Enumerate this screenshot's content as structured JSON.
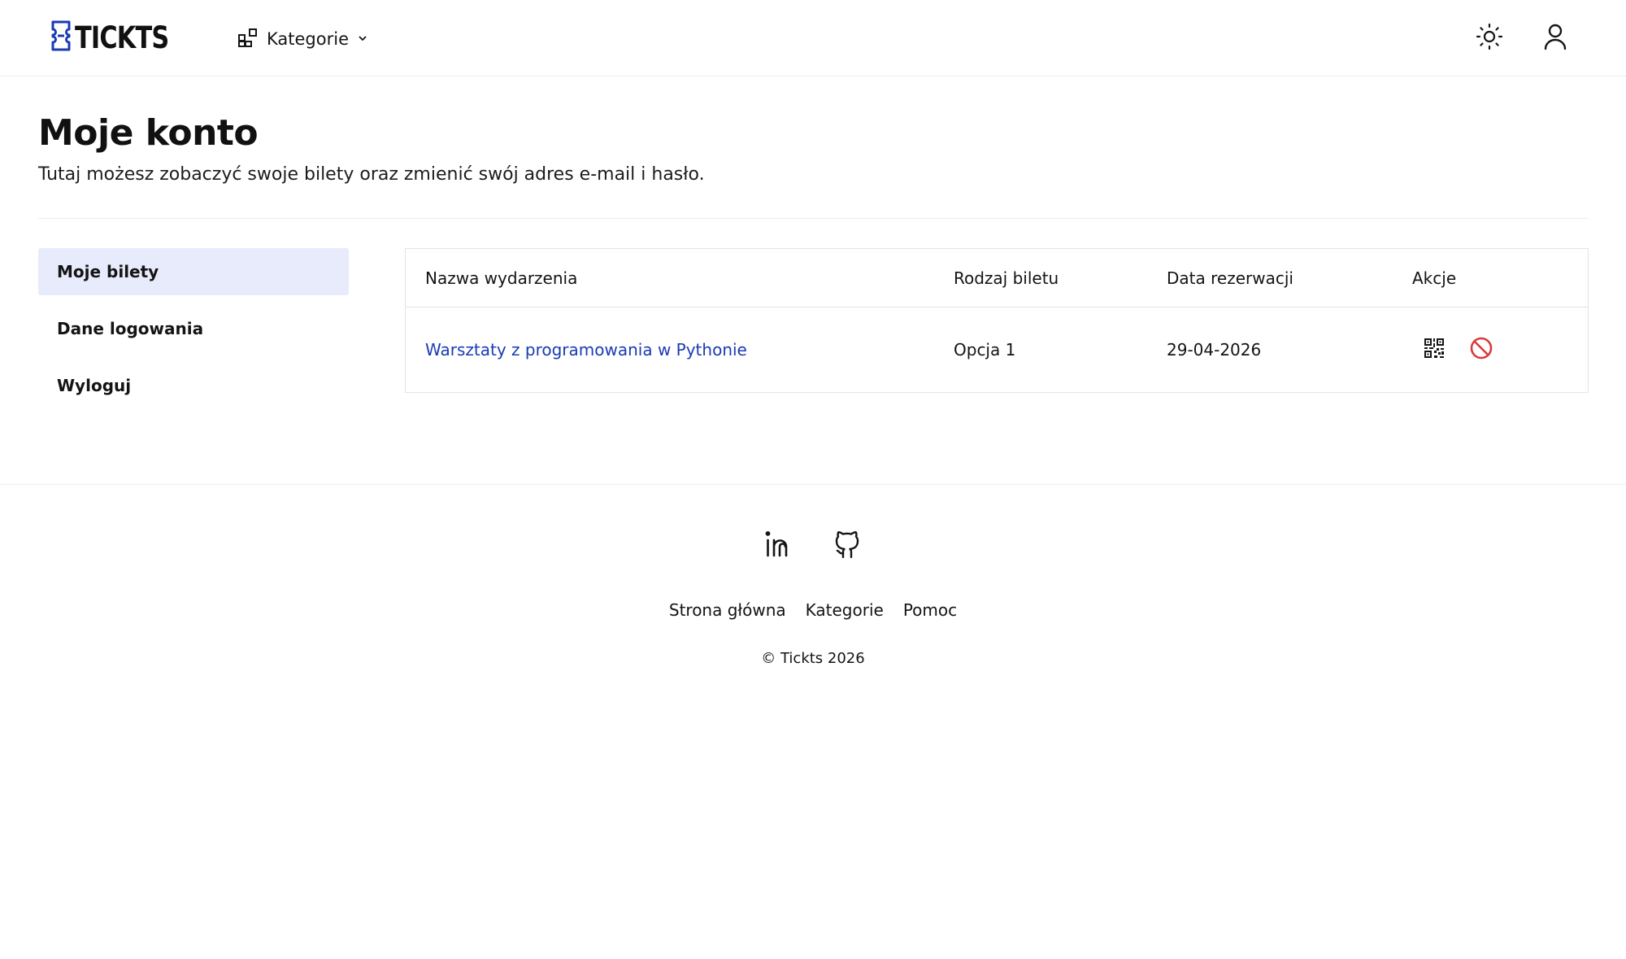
{
  "header": {
    "logo_text": "TICKTS",
    "categories_label": "Kategorie"
  },
  "page": {
    "title": "Moje konto",
    "subtitle": "Tutaj możesz zobaczyć swoje bilety oraz zmienić swój adres e-mail i hasło."
  },
  "sidebar": {
    "items": [
      {
        "label": "Moje bilety",
        "active": true
      },
      {
        "label": "Dane logowania",
        "active": false
      },
      {
        "label": "Wyloguj",
        "active": false
      }
    ]
  },
  "table": {
    "headers": [
      "Nazwa wydarzenia",
      "Rodzaj biletu",
      "Data rezerwacji",
      "Akcje"
    ],
    "rows": [
      {
        "event": "Warsztaty z programowania w Pythonie",
        "ticket_type": "Opcja 1",
        "date": "29-04-2026"
      }
    ]
  },
  "footer": {
    "links": [
      "Strona główna",
      "Kategorie",
      "Pomoc"
    ],
    "copyright": "© Tickts 2026"
  },
  "colors": {
    "brand": "#1a3bb3",
    "active_bg": "#e8ebfb",
    "danger": "#d93a3a"
  },
  "icons": {
    "logo": "ticket-icon",
    "categories": "grid-icon",
    "theme": "sun-icon",
    "user": "user-icon",
    "qr": "qr-code-icon",
    "cancel": "ban-icon",
    "linkedin": "linkedin-icon",
    "github": "github-icon"
  }
}
